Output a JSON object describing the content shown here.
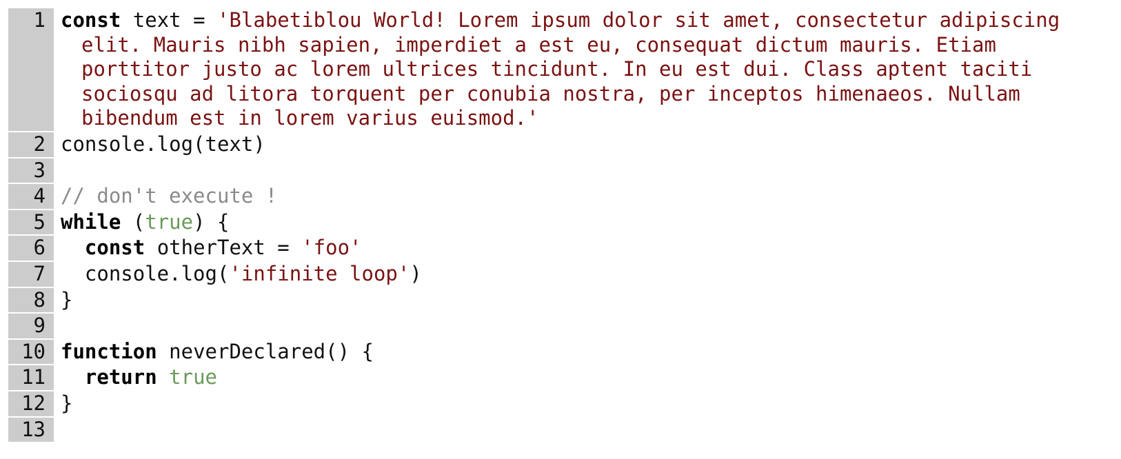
{
  "editor": {
    "lines": [
      {
        "number": "1",
        "tokens": [
          {
            "text": "const",
            "kind": "kw"
          },
          {
            "text": " text = ",
            "kind": "plain"
          },
          {
            "text": "'Blabetiblou World! Lorem ipsum dolor sit amet, consectetur adipiscing elit. Mauris nibh sapien, imperdiet a est eu, consequat dictum mauris. Etiam porttitor justo ac lorem ultrices tincidunt. In eu est dui. Class aptent taciti sociosqu ad litora torquent per conubia nostra, per inceptos himenaeos. Nullam bibendum est in lorem varius euismod.'",
            "kind": "str"
          }
        ],
        "wrapped": true
      },
      {
        "number": "2",
        "tokens": [
          {
            "text": "console.log(text)",
            "kind": "plain"
          }
        ]
      },
      {
        "number": "3",
        "tokens": []
      },
      {
        "number": "4",
        "tokens": [
          {
            "text": "// don't execute !",
            "kind": "cmt"
          }
        ]
      },
      {
        "number": "5",
        "tokens": [
          {
            "text": "while",
            "kind": "kw"
          },
          {
            "text": " (",
            "kind": "plain"
          },
          {
            "text": "true",
            "kind": "bool"
          },
          {
            "text": ") {",
            "kind": "plain"
          }
        ]
      },
      {
        "number": "6",
        "tokens": [
          {
            "text": "  ",
            "kind": "plain"
          },
          {
            "text": "const",
            "kind": "kw"
          },
          {
            "text": " otherText = ",
            "kind": "plain"
          },
          {
            "text": "'foo'",
            "kind": "str"
          }
        ]
      },
      {
        "number": "7",
        "tokens": [
          {
            "text": "  console.log(",
            "kind": "plain"
          },
          {
            "text": "'infinite loop'",
            "kind": "str"
          },
          {
            "text": ")",
            "kind": "plain"
          }
        ]
      },
      {
        "number": "8",
        "tokens": [
          {
            "text": "}",
            "kind": "plain"
          }
        ]
      },
      {
        "number": "9",
        "tokens": []
      },
      {
        "number": "10",
        "tokens": [
          {
            "text": "function",
            "kind": "kw"
          },
          {
            "text": " neverDeclared() {",
            "kind": "plain"
          }
        ]
      },
      {
        "number": "11",
        "tokens": [
          {
            "text": "  ",
            "kind": "plain"
          },
          {
            "text": "return",
            "kind": "kw"
          },
          {
            "text": " ",
            "kind": "plain"
          },
          {
            "text": "true",
            "kind": "bool"
          }
        ]
      },
      {
        "number": "12",
        "tokens": [
          {
            "text": "}",
            "kind": "plain"
          }
        ]
      },
      {
        "number": "13",
        "tokens": []
      }
    ]
  },
  "colors": {
    "gutter_background": "#cccccc",
    "keyword": "#000000",
    "string": "#7a1212",
    "comment": "#8a8a8a",
    "boolean": "#6a9a5a",
    "text": "#111111",
    "background": "#ffffff"
  }
}
